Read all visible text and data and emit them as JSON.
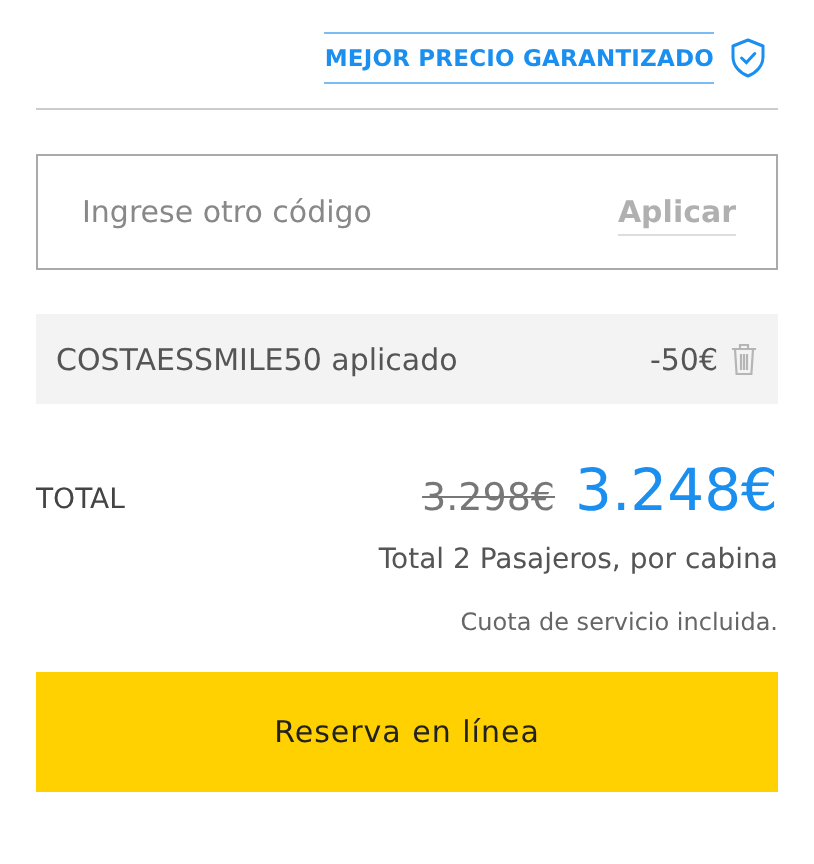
{
  "guarantee": {
    "label": "MEJOR PRECIO GARANTIZADO"
  },
  "promo_field": {
    "placeholder": "Ingrese otro código",
    "apply_button": {
      "label": "Aplicar",
      "disabled": true
    }
  },
  "applied_code": {
    "label": "COSTAESSMILE50 aplicado",
    "discount": "-50€"
  },
  "total": {
    "label": "TOTAL",
    "old_price": "3.298€",
    "price": "3.248€",
    "passengers": "Total 2 Pasajeros, por cabina",
    "note": "Cuota de servicio incluida."
  },
  "book_button": {
    "label": "Reserva en línea"
  }
}
